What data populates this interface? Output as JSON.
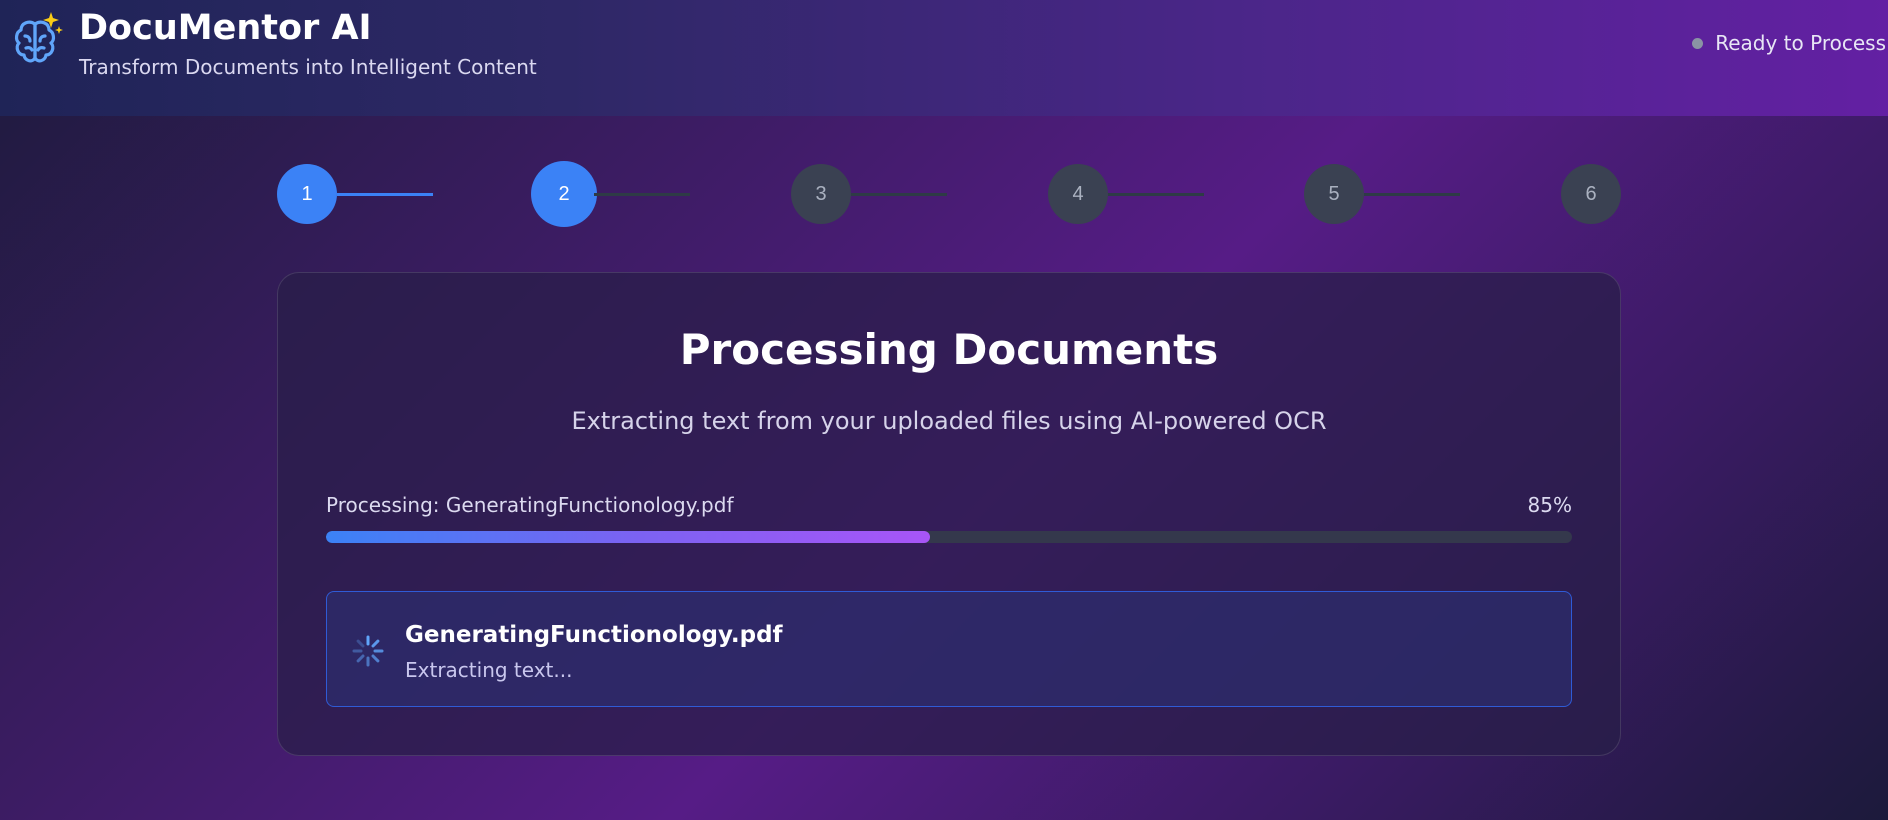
{
  "header": {
    "title": "DocuMentor AI",
    "subtitle": "Transform Documents into Intelligent Content",
    "status_text": "Ready to Process",
    "logo_icon": "brain-sparkle-icon"
  },
  "stepper": {
    "steps": [
      {
        "label": "1",
        "state": "done"
      },
      {
        "label": "2",
        "state": "current"
      },
      {
        "label": "3",
        "state": "pending"
      },
      {
        "label": "4",
        "state": "pending"
      },
      {
        "label": "5",
        "state": "pending"
      },
      {
        "label": "6",
        "state": "pending"
      }
    ]
  },
  "processing": {
    "title": "Processing Documents",
    "subtitle": "Extracting text from your uploaded files using AI-powered OCR",
    "progress_label": "Processing: GeneratingFunctionology.pdf",
    "progress_percent_text": "85%",
    "progress_bar_fill_fraction": 0.485,
    "file": {
      "name": "GeneratingFunctionology.pdf",
      "status": "Extracting text...",
      "icon": "loading-spinner-icon"
    }
  },
  "colors": {
    "accent": "#3b82f6",
    "accent_purple": "#a855f7",
    "pending_step": "#3a4152",
    "status_dot": "#8a94a4",
    "file_border": "#2f5bd6"
  }
}
